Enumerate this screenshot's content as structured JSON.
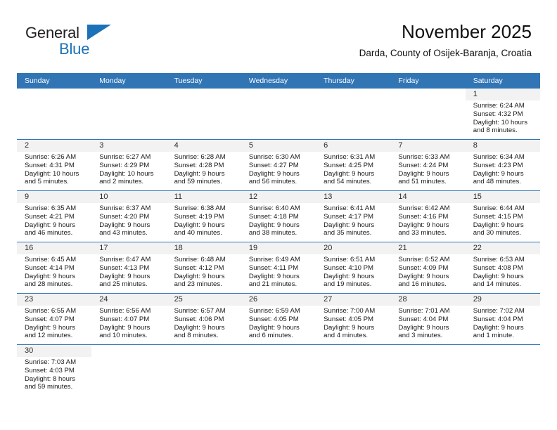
{
  "brand": {
    "name_part1": "General",
    "name_part2": "Blue",
    "flag_icon": "triangle-flag-icon"
  },
  "header": {
    "title": "November 2025",
    "subtitle": "Darda, County of Osijek-Baranja, Croatia"
  },
  "calendar": {
    "weekday_headers": [
      "Sunday",
      "Monday",
      "Tuesday",
      "Wednesday",
      "Thursday",
      "Friday",
      "Saturday"
    ],
    "accent_color": "#3175b5",
    "daynum_band_color": "#f2f2f2",
    "weeks": [
      [
        {
          "blank": true
        },
        {
          "blank": true
        },
        {
          "blank": true
        },
        {
          "blank": true
        },
        {
          "blank": true
        },
        {
          "blank": true
        },
        {
          "day": "1",
          "sunrise": "Sunrise: 6:24 AM",
          "sunset": "Sunset: 4:32 PM",
          "daylight_line1": "Daylight: 10 hours",
          "daylight_line2": "and 8 minutes."
        }
      ],
      [
        {
          "day": "2",
          "sunrise": "Sunrise: 6:26 AM",
          "sunset": "Sunset: 4:31 PM",
          "daylight_line1": "Daylight: 10 hours",
          "daylight_line2": "and 5 minutes."
        },
        {
          "day": "3",
          "sunrise": "Sunrise: 6:27 AM",
          "sunset": "Sunset: 4:29 PM",
          "daylight_line1": "Daylight: 10 hours",
          "daylight_line2": "and 2 minutes."
        },
        {
          "day": "4",
          "sunrise": "Sunrise: 6:28 AM",
          "sunset": "Sunset: 4:28 PM",
          "daylight_line1": "Daylight: 9 hours",
          "daylight_line2": "and 59 minutes."
        },
        {
          "day": "5",
          "sunrise": "Sunrise: 6:30 AM",
          "sunset": "Sunset: 4:27 PM",
          "daylight_line1": "Daylight: 9 hours",
          "daylight_line2": "and 56 minutes."
        },
        {
          "day": "6",
          "sunrise": "Sunrise: 6:31 AM",
          "sunset": "Sunset: 4:25 PM",
          "daylight_line1": "Daylight: 9 hours",
          "daylight_line2": "and 54 minutes."
        },
        {
          "day": "7",
          "sunrise": "Sunrise: 6:33 AM",
          "sunset": "Sunset: 4:24 PM",
          "daylight_line1": "Daylight: 9 hours",
          "daylight_line2": "and 51 minutes."
        },
        {
          "day": "8",
          "sunrise": "Sunrise: 6:34 AM",
          "sunset": "Sunset: 4:23 PM",
          "daylight_line1": "Daylight: 9 hours",
          "daylight_line2": "and 48 minutes."
        }
      ],
      [
        {
          "day": "9",
          "sunrise": "Sunrise: 6:35 AM",
          "sunset": "Sunset: 4:21 PM",
          "daylight_line1": "Daylight: 9 hours",
          "daylight_line2": "and 46 minutes."
        },
        {
          "day": "10",
          "sunrise": "Sunrise: 6:37 AM",
          "sunset": "Sunset: 4:20 PM",
          "daylight_line1": "Daylight: 9 hours",
          "daylight_line2": "and 43 minutes."
        },
        {
          "day": "11",
          "sunrise": "Sunrise: 6:38 AM",
          "sunset": "Sunset: 4:19 PM",
          "daylight_line1": "Daylight: 9 hours",
          "daylight_line2": "and 40 minutes."
        },
        {
          "day": "12",
          "sunrise": "Sunrise: 6:40 AM",
          "sunset": "Sunset: 4:18 PM",
          "daylight_line1": "Daylight: 9 hours",
          "daylight_line2": "and 38 minutes."
        },
        {
          "day": "13",
          "sunrise": "Sunrise: 6:41 AM",
          "sunset": "Sunset: 4:17 PM",
          "daylight_line1": "Daylight: 9 hours",
          "daylight_line2": "and 35 minutes."
        },
        {
          "day": "14",
          "sunrise": "Sunrise: 6:42 AM",
          "sunset": "Sunset: 4:16 PM",
          "daylight_line1": "Daylight: 9 hours",
          "daylight_line2": "and 33 minutes."
        },
        {
          "day": "15",
          "sunrise": "Sunrise: 6:44 AM",
          "sunset": "Sunset: 4:15 PM",
          "daylight_line1": "Daylight: 9 hours",
          "daylight_line2": "and 30 minutes."
        }
      ],
      [
        {
          "day": "16",
          "sunrise": "Sunrise: 6:45 AM",
          "sunset": "Sunset: 4:14 PM",
          "daylight_line1": "Daylight: 9 hours",
          "daylight_line2": "and 28 minutes."
        },
        {
          "day": "17",
          "sunrise": "Sunrise: 6:47 AM",
          "sunset": "Sunset: 4:13 PM",
          "daylight_line1": "Daylight: 9 hours",
          "daylight_line2": "and 25 minutes."
        },
        {
          "day": "18",
          "sunrise": "Sunrise: 6:48 AM",
          "sunset": "Sunset: 4:12 PM",
          "daylight_line1": "Daylight: 9 hours",
          "daylight_line2": "and 23 minutes."
        },
        {
          "day": "19",
          "sunrise": "Sunrise: 6:49 AM",
          "sunset": "Sunset: 4:11 PM",
          "daylight_line1": "Daylight: 9 hours",
          "daylight_line2": "and 21 minutes."
        },
        {
          "day": "20",
          "sunrise": "Sunrise: 6:51 AM",
          "sunset": "Sunset: 4:10 PM",
          "daylight_line1": "Daylight: 9 hours",
          "daylight_line2": "and 19 minutes."
        },
        {
          "day": "21",
          "sunrise": "Sunrise: 6:52 AM",
          "sunset": "Sunset: 4:09 PM",
          "daylight_line1": "Daylight: 9 hours",
          "daylight_line2": "and 16 minutes."
        },
        {
          "day": "22",
          "sunrise": "Sunrise: 6:53 AM",
          "sunset": "Sunset: 4:08 PM",
          "daylight_line1": "Daylight: 9 hours",
          "daylight_line2": "and 14 minutes."
        }
      ],
      [
        {
          "day": "23",
          "sunrise": "Sunrise: 6:55 AM",
          "sunset": "Sunset: 4:07 PM",
          "daylight_line1": "Daylight: 9 hours",
          "daylight_line2": "and 12 minutes."
        },
        {
          "day": "24",
          "sunrise": "Sunrise: 6:56 AM",
          "sunset": "Sunset: 4:07 PM",
          "daylight_line1": "Daylight: 9 hours",
          "daylight_line2": "and 10 minutes."
        },
        {
          "day": "25",
          "sunrise": "Sunrise: 6:57 AM",
          "sunset": "Sunset: 4:06 PM",
          "daylight_line1": "Daylight: 9 hours",
          "daylight_line2": "and 8 minutes."
        },
        {
          "day": "26",
          "sunrise": "Sunrise: 6:59 AM",
          "sunset": "Sunset: 4:05 PM",
          "daylight_line1": "Daylight: 9 hours",
          "daylight_line2": "and 6 minutes."
        },
        {
          "day": "27",
          "sunrise": "Sunrise: 7:00 AM",
          "sunset": "Sunset: 4:05 PM",
          "daylight_line1": "Daylight: 9 hours",
          "daylight_line2": "and 4 minutes."
        },
        {
          "day": "28",
          "sunrise": "Sunrise: 7:01 AM",
          "sunset": "Sunset: 4:04 PM",
          "daylight_line1": "Daylight: 9 hours",
          "daylight_line2": "and 3 minutes."
        },
        {
          "day": "29",
          "sunrise": "Sunrise: 7:02 AM",
          "sunset": "Sunset: 4:04 PM",
          "daylight_line1": "Daylight: 9 hours",
          "daylight_line2": "and 1 minute."
        }
      ],
      [
        {
          "day": "30",
          "sunrise": "Sunrise: 7:03 AM",
          "sunset": "Sunset: 4:03 PM",
          "daylight_line1": "Daylight: 8 hours",
          "daylight_line2": "and 59 minutes."
        },
        {
          "blank": true
        },
        {
          "blank": true
        },
        {
          "blank": true
        },
        {
          "blank": true
        },
        {
          "blank": true
        },
        {
          "blank": true
        }
      ]
    ]
  }
}
